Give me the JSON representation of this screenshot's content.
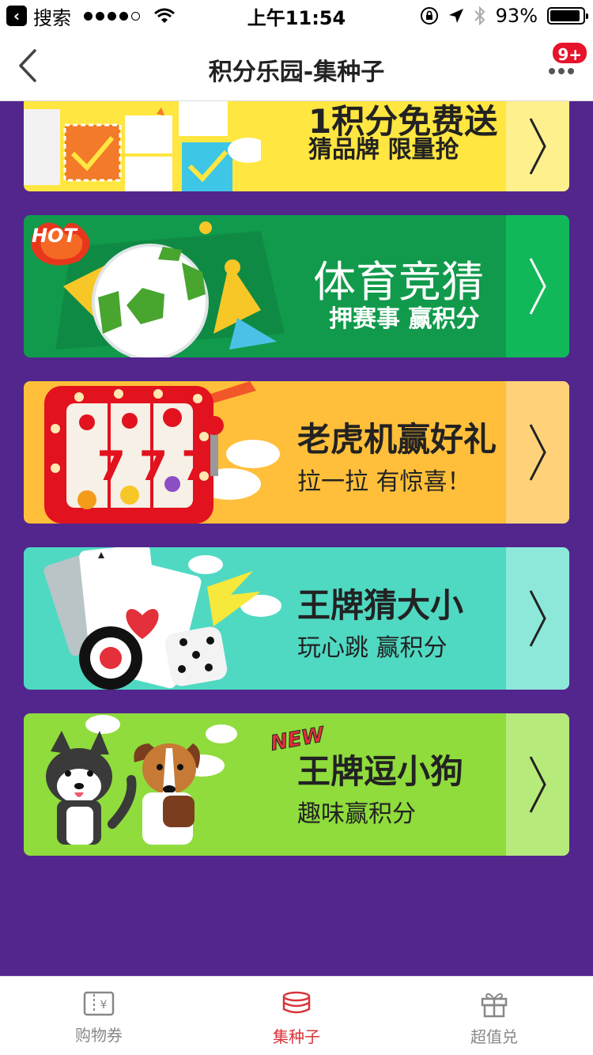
{
  "status_bar": {
    "back_app": "搜索",
    "time": "上午11:54",
    "battery": "93%",
    "battery_level": 0.93
  },
  "nav": {
    "title": "积分乐园-集种子",
    "badge": "9+"
  },
  "cards": [
    {
      "title": "1积分免费送",
      "subtitle": "猜品牌 限量抢"
    },
    {
      "title": "体育竞猜",
      "subtitle": "押赛事 赢积分",
      "tag": "HOT"
    },
    {
      "title": "老虎机赢好礼",
      "subtitle": "拉一拉 有惊喜！",
      "reels": [
        "7",
        "7",
        "7"
      ]
    },
    {
      "title": "王牌猜大小",
      "subtitle": "玩心跳 赢积分"
    },
    {
      "title": "王牌逗小狗",
      "subtitle": "趣味赢积分",
      "tag": "NEW"
    }
  ],
  "tabbar": {
    "tabs": [
      {
        "label": "购物券",
        "icon": "coupon-icon",
        "active": false
      },
      {
        "label": "集种子",
        "icon": "coins-icon",
        "active": true
      },
      {
        "label": "超值兑",
        "icon": "gift-icon",
        "active": false
      }
    ],
    "active_color": "#d9333a"
  },
  "colors": {
    "background": "#52268d",
    "card_yellow": "#ffe640",
    "card_green": "#119a4b",
    "card_orange": "#ffbf3a",
    "card_teal": "#4fd9c2",
    "card_lime": "#8fdc3c"
  }
}
